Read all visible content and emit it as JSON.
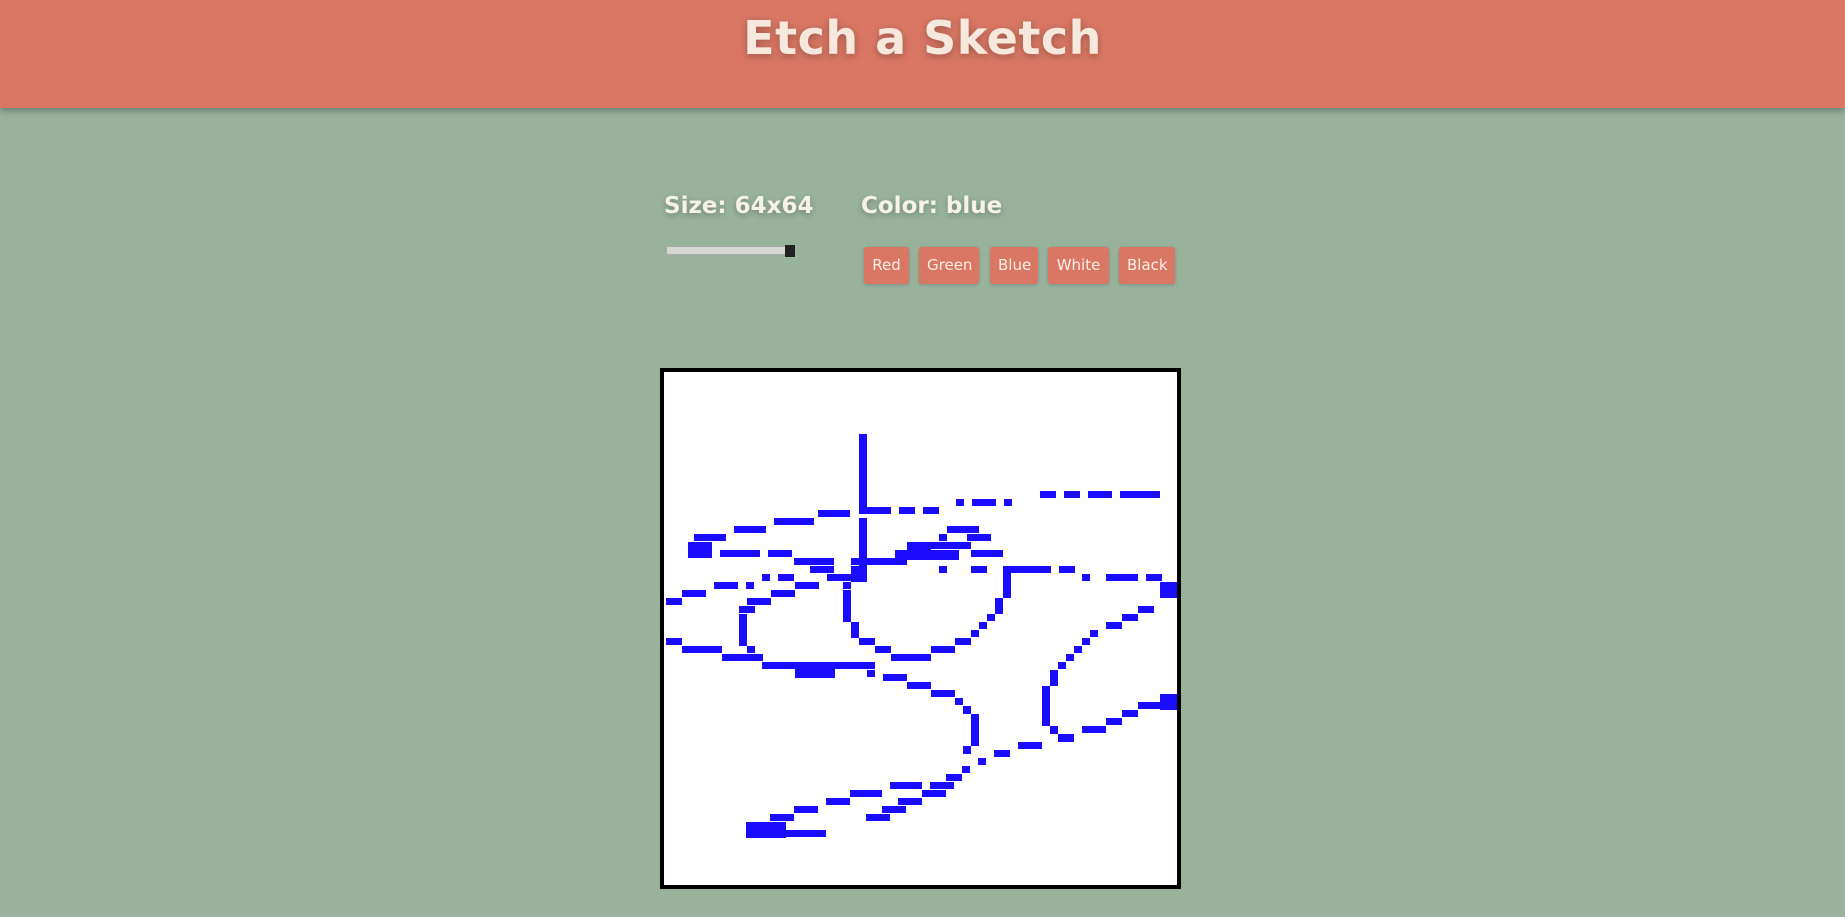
{
  "header": {
    "title": "Etch a Sketch"
  },
  "controls": {
    "size_label": "Size: 64x64",
    "color_label": "Color: blue",
    "grid_size": 64,
    "slider_level": 1.0,
    "buttons": [
      {
        "label": "Red"
      },
      {
        "label": "Green"
      },
      {
        "label": "Blue"
      },
      {
        "label": "White"
      },
      {
        "label": "Black"
      }
    ]
  },
  "sketch": {
    "ink_color": "#1a0dff",
    "background_color": "#ffffff"
  },
  "colors": {
    "header_bg": "#d97764",
    "page_bg": "#98b29c",
    "button_bg": "#d97764",
    "board_border": "#000000"
  }
}
